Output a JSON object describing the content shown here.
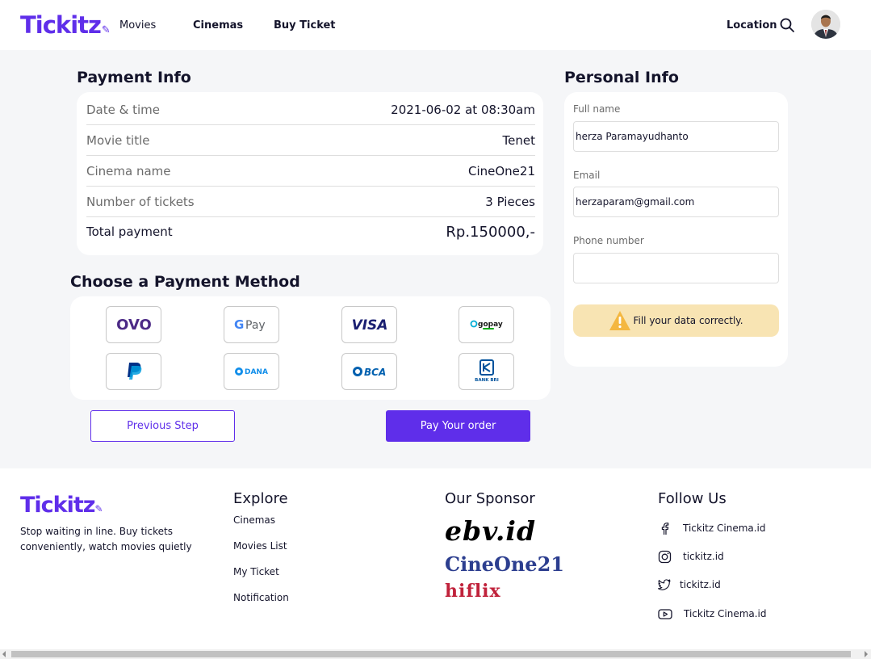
{
  "navbar": {
    "logo": "Tickitz",
    "links": [
      "Movies",
      "Cinemas",
      "Buy Ticket"
    ],
    "location": "Location",
    "search_icon": "search-icon",
    "avatar_icon": "user-avatar"
  },
  "payment_info": {
    "title": "Payment Info",
    "rows": [
      {
        "label": "Date & time",
        "value": "2021-06-02 at 08:30am"
      },
      {
        "label": "Movie title",
        "value": "Tenet"
      },
      {
        "label": "Cinema name",
        "value": "CineOne21"
      },
      {
        "label": "Number of tickets",
        "value": "3 Pieces"
      },
      {
        "label": "Total payment",
        "value": "Rp.150000,-"
      }
    ]
  },
  "payment_method": {
    "title": "Choose a Payment Method",
    "methods": [
      "OVO",
      "Google Pay",
      "VISA",
      "gopay",
      "PayPal",
      "DANA",
      "BCA",
      "BANK BRI"
    ]
  },
  "buttons": {
    "previous": "Previous Step",
    "pay": "Pay Your order"
  },
  "personal_info": {
    "title": "Personal Info",
    "full_name_label": "Full name",
    "full_name_value": "herza Paramayudhanto",
    "email_label": "Email",
    "email_value": "herzaparam@gmail.com",
    "phone_label": "Phone number",
    "phone_value": "",
    "warning": "Fill your data correctly."
  },
  "footer": {
    "logo": "Tickitz",
    "description": "Stop waiting in line. Buy tickets conveniently, watch movies quietly",
    "explore_title": "Explore",
    "explore_links": [
      "Cinemas",
      "Movies List",
      "My Ticket",
      "Notification"
    ],
    "sponsor_title": "Our Sponsor",
    "sponsors": [
      "ebv.id",
      "CineOne21",
      "hiflix"
    ],
    "follow_title": "Follow Us",
    "follow": [
      {
        "icon": "facebook-icon",
        "label": "Tickitz Cinema.id"
      },
      {
        "icon": "instagram-icon",
        "label": "tickitz.id"
      },
      {
        "icon": "twitter-icon",
        "label": "tickitz.id"
      },
      {
        "icon": "youtube-icon",
        "label": "Tickitz Cinema.id"
      }
    ]
  },
  "colors": {
    "brand": "#5f2eea",
    "background": "#f5f6f8",
    "warning_bg": "#f8e4b3",
    "warning_icon": "#f4b740"
  }
}
